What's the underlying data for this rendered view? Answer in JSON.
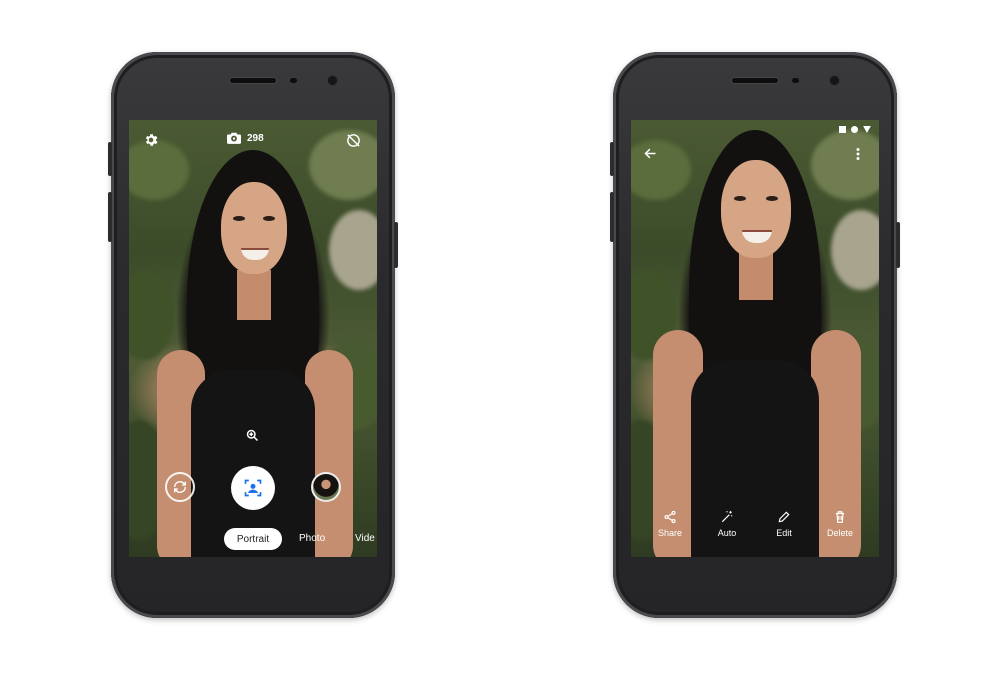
{
  "camera": {
    "shot_count": "298",
    "modes": {
      "active": "Portrait",
      "photo": "Photo",
      "video": "Vide"
    },
    "icons": {
      "settings": "gear-icon",
      "counter": "camera-icon",
      "flash_off": "flash-off-icon",
      "zoom": "zoom-in-icon",
      "switch_camera": "switch-camera-icon",
      "shutter": "portrait-shutter-icon",
      "thumbnail": "gallery-thumbnail"
    }
  },
  "viewer": {
    "actions": [
      {
        "label": "Share",
        "icon": "share-icon"
      },
      {
        "label": "Auto",
        "icon": "magic-wand-icon"
      },
      {
        "label": "Edit",
        "icon": "pencil-icon"
      },
      {
        "label": "Delete",
        "icon": "trash-icon"
      }
    ],
    "icons": {
      "back": "back-arrow-icon",
      "menu": "more-vert-icon",
      "status": [
        "square-icon",
        "circle-icon",
        "triangle-icon"
      ]
    }
  },
  "colors": {
    "phone_body": "#2c2c2e",
    "ui_text": "#ffffff",
    "pill_bg": "#ffffff",
    "shutter_accent": "#1a73e8"
  }
}
